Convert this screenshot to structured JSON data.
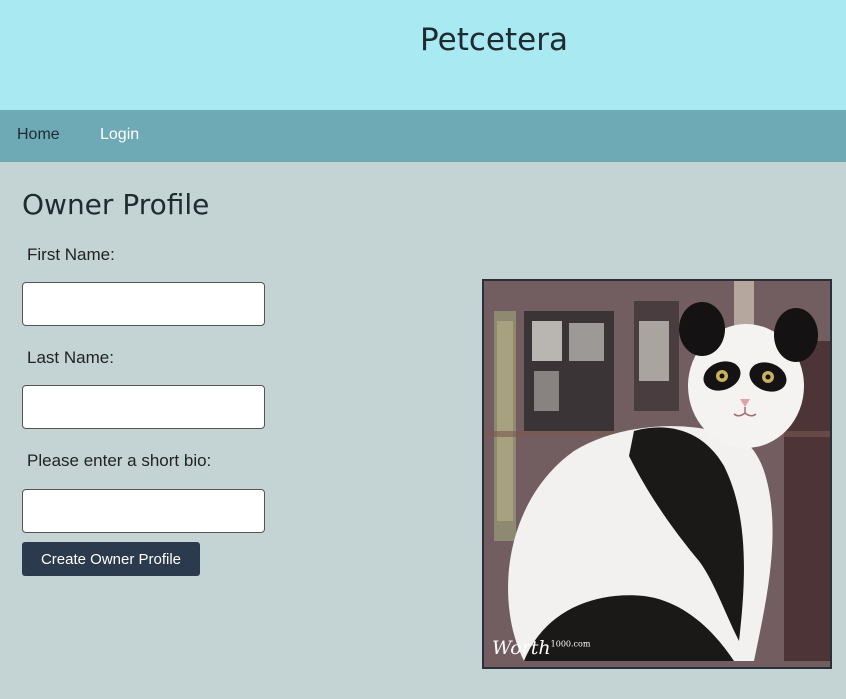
{
  "header": {
    "site_title": "Petcetera"
  },
  "nav": {
    "home_label": "Home",
    "login_label": "Login"
  },
  "form": {
    "heading": "Owner Profile",
    "first_name_label": "First Name:",
    "first_name_value": "",
    "last_name_label": "Last Name:",
    "last_name_value": "",
    "bio_label": "Please enter a short bio:",
    "bio_value": "",
    "submit_label": "Create Owner Profile"
  },
  "photo": {
    "watermark_text": "Worth",
    "watermark_sup": "1000.com"
  },
  "colors": {
    "header_bg": "#a8e9f2",
    "nav_bg": "#6eaab6",
    "page_bg": "#c4d3d4",
    "button_bg": "#2b3a4c"
  }
}
